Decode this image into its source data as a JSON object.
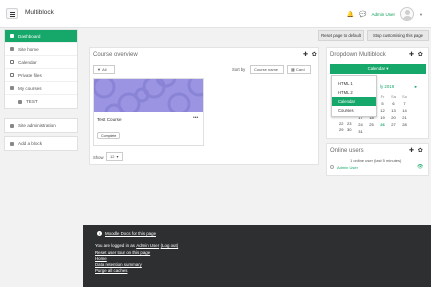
{
  "navbar": {
    "brand": "Multiblock",
    "user_name": "Admin User",
    "icons": [
      "hamburger-icon",
      "bell-icon",
      "chat-icon",
      "chevron-down-icon"
    ]
  },
  "drawer": {
    "group1": [
      {
        "label": "Dashboard",
        "icon": "dashboard-icon",
        "active": true
      },
      {
        "label": "Site home",
        "icon": "home-icon"
      },
      {
        "label": "Calendar",
        "icon": "calendar-icon"
      },
      {
        "label": "Private files",
        "icon": "file-icon"
      },
      {
        "label": "My courses",
        "icon": "graduation-cap-icon"
      },
      {
        "label": "TEST",
        "icon": "folder-icon",
        "sub": true
      }
    ],
    "group2": [
      {
        "label": "Site administration",
        "icon": "wrench-icon"
      }
    ],
    "group3": [
      {
        "label": "Add a block",
        "icon": "plus-icon"
      }
    ]
  },
  "header": {
    "reset_label": "Reset page to default",
    "stop_label": "Stop customising this page"
  },
  "course_overview": {
    "title": "Course overview",
    "controls": "✚ ✿",
    "filter_label": "All",
    "sort_label": "Sort by",
    "sort_value": "Course name",
    "view_value": "Card",
    "course_name": "Test Course",
    "course_menu": "•••",
    "status_badge": "Complete",
    "show_label": "Show",
    "show_value": "12"
  },
  "dropdown_block": {
    "title": "Dropdown Multiblock",
    "controls": "✚ ✿",
    "button_label": "Calendar ▾",
    "menu_items": [
      "HTML 1",
      "HTML 2",
      "Calendar",
      "Courses"
    ],
    "selected_item": "Calendar",
    "month_label": "ly 2019",
    "next_arrow": "►",
    "weekday_headers": [
      "We",
      "Th",
      "Fr",
      "Sa",
      "Su"
    ],
    "weeks": [
      [
        "",
        "",
        "",
        "",
        ""
      ],
      [
        "3",
        "4",
        "5",
        "6",
        "7"
      ],
      [
        "10",
        "11",
        "12",
        "13",
        "14"
      ],
      [
        "17",
        "18",
        "19",
        "20",
        "21"
      ],
      [
        "24",
        "25",
        "26",
        "27",
        "28"
      ],
      [
        "31",
        "",
        "",
        "",
        ""
      ]
    ],
    "partial_left": [
      "",
      "",
      "",
      "22",
      "29"
    ],
    "partial_left2": [
      "",
      "",
      "",
      "23",
      "30"
    ]
  },
  "online_users": {
    "title": "Online users",
    "controls": "✚ ✿",
    "summary": "1 online user (last 5 minutes)",
    "user": "Admin User"
  },
  "footer": {
    "docs_link": "Moodle Docs for this page",
    "logged_prefix": "You are logged in as",
    "logged_user": "Admin User",
    "logout": "(Log out)",
    "links": [
      "Reset user tour on this page",
      "Home",
      "Data retention summary",
      "Purge all caches"
    ]
  }
}
